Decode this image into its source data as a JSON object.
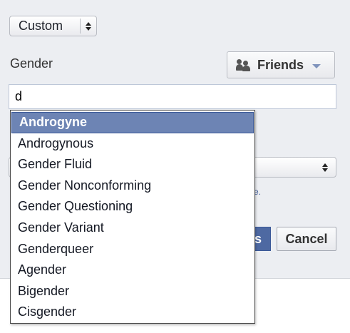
{
  "privacy_select": {
    "value": "Custom"
  },
  "gender_label": "Gender",
  "audience_button": {
    "label": "Friends",
    "icon": "friends-icon"
  },
  "gender_input": {
    "value": "d"
  },
  "autocomplete": {
    "options": [
      "Androgyne",
      "Androgynous",
      "Gender Fluid",
      "Gender Nonconforming",
      "Gender Questioning",
      "Gender Variant",
      "Genderqueer",
      "Agender",
      "Bigender",
      "Cisgender"
    ],
    "selected_index": 0,
    "highlight_color": "#6d84b4"
  },
  "background": {
    "link_fragment": "re.",
    "save_fragment": "s",
    "cancel_label": "Cancel"
  },
  "colors": {
    "panel_bg": "#eceef2",
    "link": "#3b5998",
    "save_bg": "#4e69a2"
  }
}
